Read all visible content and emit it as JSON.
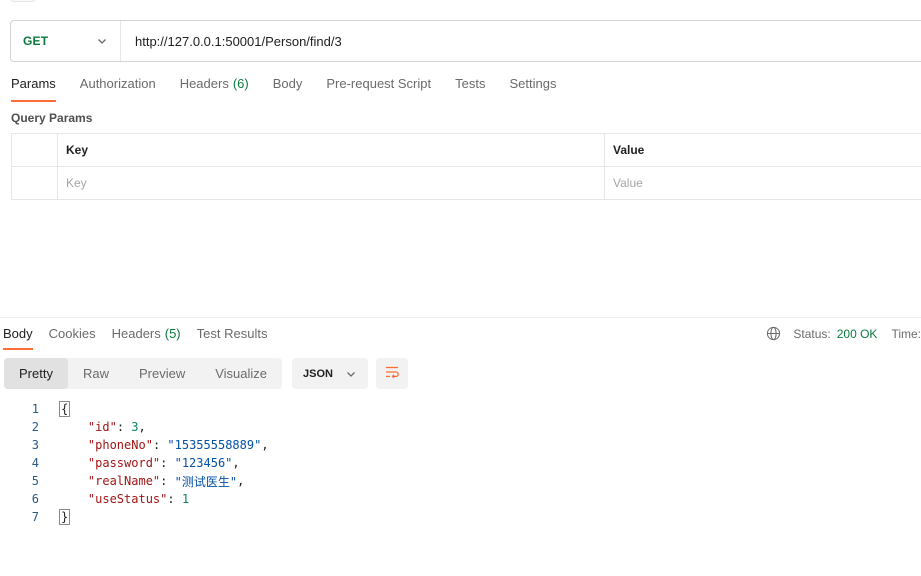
{
  "request": {
    "method": "GET",
    "url": "http://127.0.0.1:50001/Person/find/3"
  },
  "request_tabs": [
    {
      "label": "Params",
      "count": ""
    },
    {
      "label": "Authorization",
      "count": ""
    },
    {
      "label": "Headers",
      "count": "(6)"
    },
    {
      "label": "Body",
      "count": ""
    },
    {
      "label": "Pre-request Script",
      "count": ""
    },
    {
      "label": "Tests",
      "count": ""
    },
    {
      "label": "Settings",
      "count": ""
    }
  ],
  "query_params": {
    "title": "Query Params",
    "headers": {
      "key": "Key",
      "value": "Value"
    },
    "placeholders": {
      "key": "Key",
      "value": "Value"
    }
  },
  "response_tabs": [
    {
      "label": "Body",
      "count": ""
    },
    {
      "label": "Cookies",
      "count": ""
    },
    {
      "label": "Headers",
      "count": "(5)"
    },
    {
      "label": "Test Results",
      "count": ""
    }
  ],
  "response_status": {
    "status_label": "Status:",
    "status_value": "200 OK",
    "time_label": "Time:"
  },
  "body_view": {
    "modes": [
      "Pretty",
      "Raw",
      "Preview",
      "Visualize"
    ],
    "active_mode": "Pretty",
    "format": "JSON"
  },
  "code_lines": [
    {
      "n": "1",
      "type": "open",
      "text": "{"
    },
    {
      "n": "2",
      "type": "pair",
      "key": "\"id\"",
      "sep": ": ",
      "val": "3",
      "vtype": "num",
      "tail": ","
    },
    {
      "n": "3",
      "type": "pair",
      "key": "\"phoneNo\"",
      "sep": ": ",
      "val": "\"15355558889\"",
      "vtype": "str",
      "tail": ","
    },
    {
      "n": "4",
      "type": "pair",
      "key": "\"password\"",
      "sep": ": ",
      "val": "\"123456\"",
      "vtype": "str",
      "tail": ","
    },
    {
      "n": "5",
      "type": "pair",
      "key": "\"realName\"",
      "sep": ": ",
      "val": "\"测试医生\"",
      "vtype": "str",
      "tail": ","
    },
    {
      "n": "6",
      "type": "pair",
      "key": "\"useStatus\"",
      "sep": ": ",
      "val": "1",
      "vtype": "num",
      "tail": ""
    },
    {
      "n": "7",
      "type": "close",
      "text": "}"
    }
  ],
  "colors": {
    "accent": "#ff6c37",
    "method_get": "#0b7a3e",
    "status_ok": "#0b7a3e"
  },
  "icons": {
    "method_dropdown": "chevron-down-icon",
    "globe": "globe-icon",
    "format_dropdown": "chevron-down-icon",
    "wrap": "wrap-lines-icon"
  }
}
